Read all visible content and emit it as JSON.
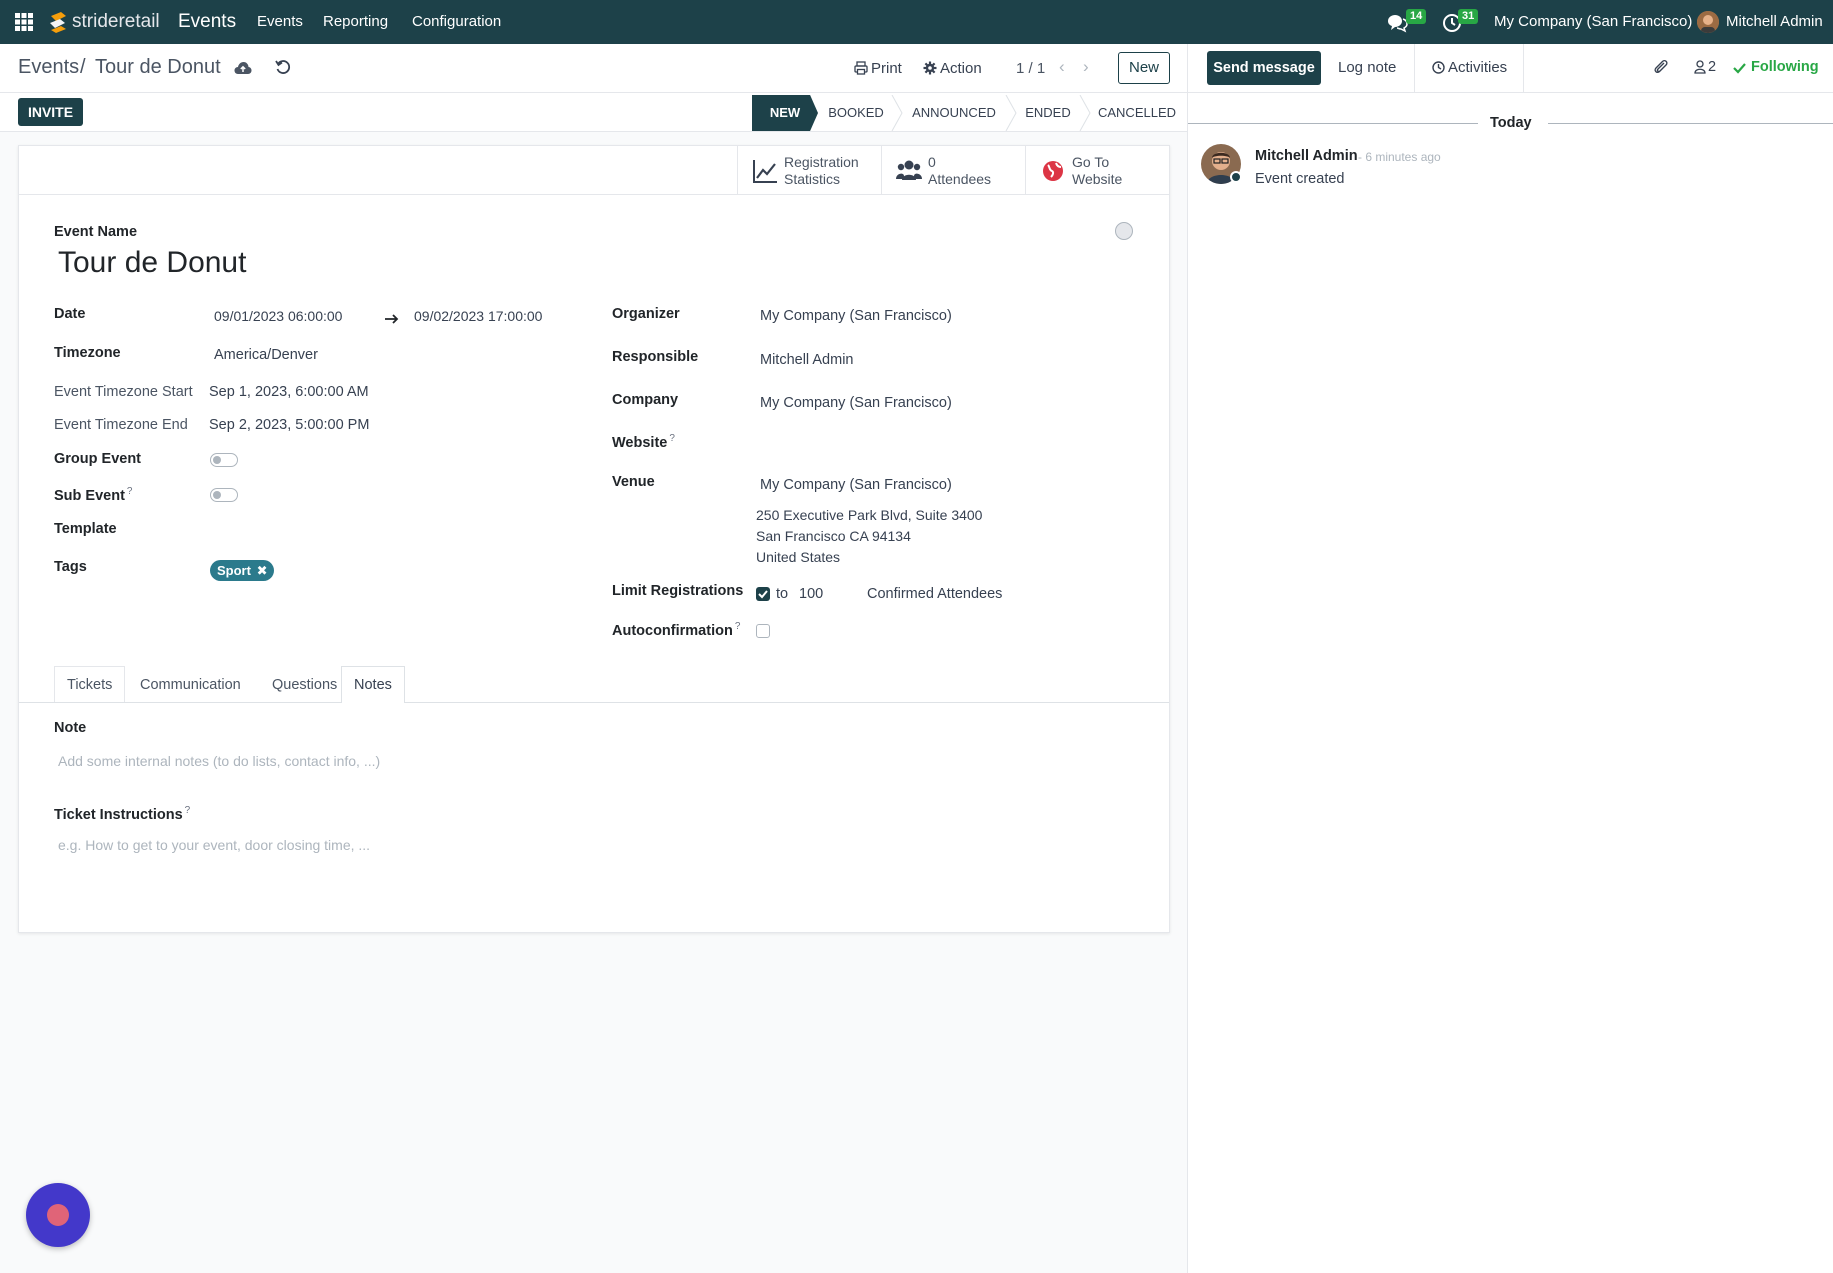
{
  "topnav": {
    "brand": "strideretail",
    "app_name": "Events",
    "menu": [
      "Events",
      "Reporting",
      "Configuration"
    ],
    "messages_count": "14",
    "activities_count": "31",
    "company": "My Company (San Francisco)",
    "user": "Mitchell Admin"
  },
  "breadcrumb": {
    "parent": "Events",
    "separator": "/",
    "current": "Tour de Donut"
  },
  "toolbar": {
    "print_label": "Print",
    "action_label": "Action",
    "pager": "1 / 1",
    "new_label": "New",
    "invite_label": "INVITE"
  },
  "stages": [
    "NEW",
    "BOOKED",
    "ANNOUNCED",
    "ENDED",
    "CANCELLED"
  ],
  "active_stage": "NEW",
  "smart_buttons": {
    "stats_line1": "Registration",
    "stats_line2": "Statistics",
    "attendees_count": "0",
    "attendees_label": "Attendees",
    "website_line1": "Go To",
    "website_line2": "Website"
  },
  "form": {
    "event_name_label": "Event Name",
    "event_name": "Tour de Donut",
    "left": {
      "date_label": "Date",
      "date_start": "09/01/2023 06:00:00",
      "date_end": "09/02/2023 17:00:00",
      "timezone_label": "Timezone",
      "timezone": "America/Denver",
      "tz_start_label": "Event Timezone Start",
      "tz_start": "Sep 1, 2023, 6:00:00 AM",
      "tz_end_label": "Event Timezone End",
      "tz_end": "Sep 2, 2023, 5:00:00 PM",
      "group_event_label": "Group Event",
      "group_event": false,
      "sub_event_label": "Sub Event",
      "sub_event": false,
      "template_label": "Template",
      "tags_label": "Tags",
      "tags": [
        "Sport"
      ]
    },
    "right": {
      "organizer_label": "Organizer",
      "organizer": "My Company (San Francisco)",
      "responsible_label": "Responsible",
      "responsible": "Mitchell Admin",
      "company_label": "Company",
      "company": "My Company (San Francisco)",
      "website_label": "Website",
      "venue_label": "Venue",
      "venue": "My Company (San Francisco)",
      "venue_address": [
        "250 Executive Park Blvd, Suite 3400",
        "San Francisco CA 94134",
        "United States"
      ],
      "limit_label": "Limit Registrations",
      "limit_enabled": true,
      "limit_to": "to",
      "limit_value": "100",
      "limit_unit": "Confirmed Attendees",
      "autoconfirm_label": "Autoconfirmation",
      "autoconfirm": false
    },
    "help_mark": "?"
  },
  "tabs": [
    "Tickets",
    "Communication",
    "Questions",
    "Notes"
  ],
  "active_tab": "Notes",
  "notes": {
    "note_label": "Note",
    "note_placeholder": "Add some internal notes (to do lists, contact info, ...)",
    "ticket_label": "Ticket Instructions",
    "ticket_placeholder": "e.g. How to get to your event, door closing time, ..."
  },
  "chatter": {
    "send_message": "Send message",
    "log_note": "Log note",
    "activities": "Activities",
    "followers_count": "2",
    "following": "Following",
    "day_label": "Today",
    "message_author": "Mitchell Admin",
    "message_time": "- 6 minutes ago",
    "message_body": "Event created"
  },
  "colors": {
    "primary": "#1d4149",
    "tag": "#2b7a8c",
    "success": "#28a745",
    "assistant_bubble": "#4338ca"
  }
}
